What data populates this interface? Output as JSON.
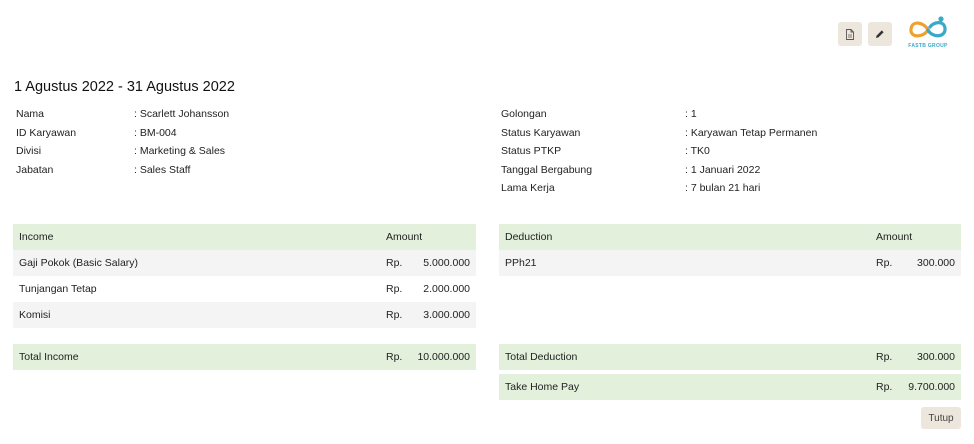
{
  "logo": {
    "text": "FASTB GROUP"
  },
  "period": "1 Agustus 2022 - 31 Agustus 2022",
  "employee_left": [
    {
      "label": "Nama",
      "value": ": Scarlett Johansson"
    },
    {
      "label": "ID Karyawan",
      "value": ": BM-004"
    },
    {
      "label": "Divisi",
      "value": ": Marketing & Sales"
    },
    {
      "label": "Jabatan",
      "value": ": Sales Staff"
    }
  ],
  "employee_right": [
    {
      "label": "Golongan",
      "value": ": 1"
    },
    {
      "label": "Status Karyawan",
      "value": ": Karyawan Tetap Permanen"
    },
    {
      "label": "Status PTKP",
      "value": ": TK0"
    },
    {
      "label": "Tanggal Bergabung",
      "value": ": 1 Januari 2022"
    },
    {
      "label": "Lama Kerja",
      "value": ": 7 bulan 21 hari"
    }
  ],
  "income": {
    "header": "Income",
    "amount_header": "Amount",
    "rows": [
      {
        "name": "Gaji Pokok (Basic Salary)",
        "currency": "Rp.",
        "amount": "5.000.000"
      },
      {
        "name": "Tunjangan Tetap",
        "currency": "Rp.",
        "amount": "2.000.000"
      },
      {
        "name": "Komisi",
        "currency": "Rp.",
        "amount": "3.000.000"
      }
    ],
    "total": {
      "label": "Total Income",
      "currency": "Rp.",
      "amount": "10.000.000"
    }
  },
  "deduction": {
    "header": "Deduction",
    "amount_header": "Amount",
    "rows": [
      {
        "name": "PPh21",
        "currency": "Rp.",
        "amount": "300.000"
      }
    ],
    "total": {
      "label": "Total Deduction",
      "currency": "Rp.",
      "amount": "300.000"
    }
  },
  "take_home_pay": {
    "label": "Take Home Pay",
    "currency": "Rp.",
    "amount": "9.700.000"
  },
  "close_label": "Tutup",
  "colors": {
    "header_bg": "#e2f0dc",
    "button_bg": "#ece6dc",
    "alt_row": "#f4f4f4",
    "logo_orange": "#f0a030",
    "logo_blue": "#3aa8c8"
  }
}
